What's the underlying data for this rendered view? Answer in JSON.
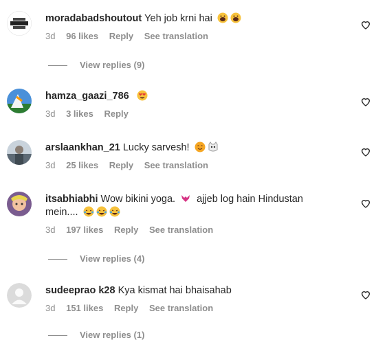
{
  "comments": [
    {
      "username": "moradabadshoutout",
      "text": "Yeh job krni hai",
      "time": "3d",
      "likes": "96 likes",
      "reply": "Reply",
      "translate": "See translation"
    },
    {
      "username": "hamza_gaazi_786",
      "text": "",
      "time": "3d",
      "likes": "3 likes",
      "reply": "Reply"
    },
    {
      "username": "arslaankhan_21",
      "text": "Lucky sarvesh!",
      "time": "3d",
      "likes": "25 likes",
      "reply": "Reply",
      "translate": "See translation"
    },
    {
      "username": "itsabhiabhi",
      "text": "Wow bikini yoga.",
      "text2": "ajjeb log hain Hindustan mein....",
      "time": "3d",
      "likes": "197 likes",
      "reply": "Reply",
      "translate": "See translation"
    },
    {
      "username": "sudeeprao k28",
      "text": "Kya kismat hai bhaisahab",
      "time": "3d",
      "likes": "151 likes",
      "reply": "Reply",
      "translate": "See translation"
    }
  ],
  "view_replies": [
    "View replies (9)",
    "View replies (4)",
    "View replies (1)"
  ],
  "colors": {
    "text": "#262626",
    "muted": "#8e8e8e"
  }
}
